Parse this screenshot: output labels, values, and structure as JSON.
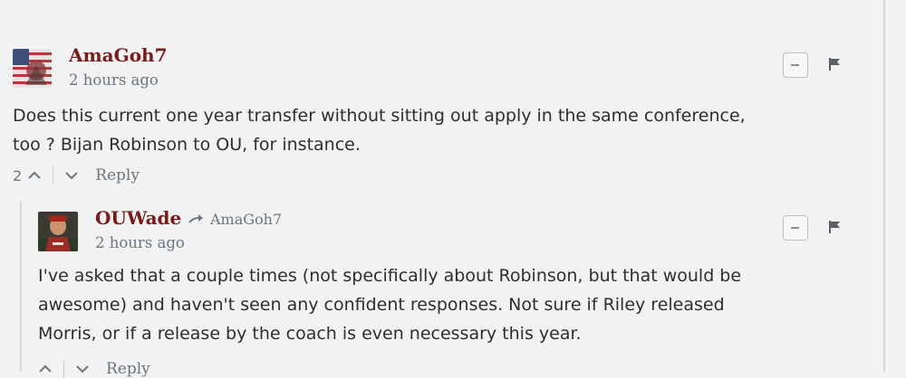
{
  "comments": [
    {
      "username": "AmaGoh7",
      "time": "2 hours ago",
      "body_lines": [
        "Does this current one year transfer without sitting out apply in the same conference,",
        "too ? Bijan Robinson to OU, for instance."
      ],
      "upvotes": "2",
      "reply_label": "Reply"
    },
    {
      "username": "OUWade",
      "reply_to": "AmaGoh7",
      "time": "2 hours ago",
      "body_lines": [
        "I've asked that a couple times (not specifically about Robinson, but that would be",
        "awesome) and haven't seen any confident responses. Not sure if Riley released",
        "Morris, or if a release by the coach is even necessary this year."
      ],
      "reply_label": "Reply"
    }
  ],
  "icons": {
    "collapse": "minus-box-icon",
    "flag": "flag-icon",
    "upvote": "chevron-up-icon",
    "downvote": "chevron-down-icon",
    "reply_arrow": "reply-arrow-icon"
  },
  "colors": {
    "username": "#7b1a1a",
    "meta": "#6b7680",
    "background": "#f2f2f2"
  }
}
